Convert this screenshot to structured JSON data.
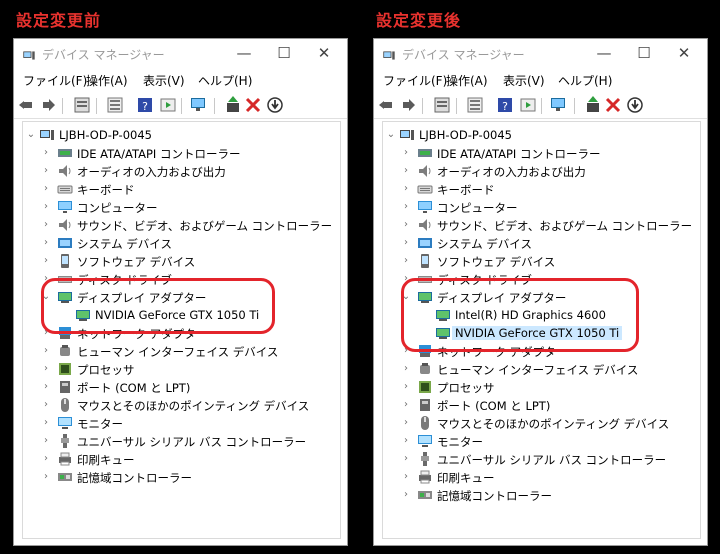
{
  "left": {
    "caption": "設定変更前",
    "window": {
      "title": "デバイス マネージャー",
      "min_glyph": "—",
      "max_glyph": "☐",
      "close_glyph": "✕",
      "menu": [
        "ファイル(F)",
        "操作(A)",
        "表示(V)",
        "ヘルプ(H)"
      ],
      "root": "LJBH-OD-P-0045",
      "categories": [
        {
          "label": "IDE ATA/ATAPI コントローラー",
          "icon": "ide-controller-icon"
        },
        {
          "label": "オーディオの入力および出力",
          "icon": "speaker-icon"
        },
        {
          "label": "キーボード",
          "icon": "keyboard-icon"
        },
        {
          "label": "コンピューター",
          "icon": "computer-icon"
        },
        {
          "label": "サウンド、ビデオ、およびゲーム コントローラー",
          "icon": "speaker-icon"
        },
        {
          "label": "システム デバイス",
          "icon": "system-device-icon"
        },
        {
          "label": "ソフトウェア デバイス",
          "icon": "software-device-icon"
        },
        {
          "label": "ディスク ドライブ",
          "icon": "disk-drive-icon"
        },
        {
          "label": "ディスプレイ アダプター",
          "icon": "display-adapter-icon",
          "expanded": true
        },
        {
          "label": "ネットワーク アダプタ",
          "icon": "network-adapter-icon"
        },
        {
          "label": "ヒューマン インターフェイス デバイス",
          "icon": "hid-icon"
        },
        {
          "label": "プロセッサ",
          "icon": "processor-icon"
        },
        {
          "label": "ポート (COM と LPT)",
          "icon": "port-icon"
        },
        {
          "label": "マウスとそのほかのポインティング デバイス",
          "icon": "mouse-icon"
        },
        {
          "label": "モニター",
          "icon": "monitor-icon"
        },
        {
          "label": "ユニバーサル シリアル バス コントローラー",
          "icon": "usb-icon"
        },
        {
          "label": "印刷キュー",
          "icon": "printer-icon"
        },
        {
          "label": "記憶域コントローラー",
          "icon": "storage-controller-icon"
        }
      ],
      "display_children": [
        "NVIDIA GeForce GTX 1050 Ti"
      ]
    }
  },
  "right": {
    "caption": "設定変更後",
    "window": {
      "title": "デバイス マネージャー",
      "min_glyph": "—",
      "max_glyph": "☐",
      "close_glyph": "✕",
      "menu": [
        "ファイル(F)",
        "操作(A)",
        "表示(V)",
        "ヘルプ(H)"
      ],
      "root": "LJBH-OD-P-0045",
      "categories": [
        {
          "label": "IDE ATA/ATAPI コントローラー",
          "icon": "ide-controller-icon"
        },
        {
          "label": "オーディオの入力および出力",
          "icon": "speaker-icon"
        },
        {
          "label": "キーボード",
          "icon": "keyboard-icon"
        },
        {
          "label": "コンピューター",
          "icon": "computer-icon"
        },
        {
          "label": "サウンド、ビデオ、およびゲーム コントローラー",
          "icon": "speaker-icon"
        },
        {
          "label": "システム デバイス",
          "icon": "system-device-icon"
        },
        {
          "label": "ソフトウェア デバイス",
          "icon": "software-device-icon"
        },
        {
          "label": "ディスク ドライブ",
          "icon": "disk-drive-icon"
        },
        {
          "label": "ディスプレイ アダプター",
          "icon": "display-adapter-icon",
          "expanded": true
        },
        {
          "label": "ネットワーク アダプタ",
          "icon": "network-adapter-icon"
        },
        {
          "label": "ヒューマン インターフェイス デバイス",
          "icon": "hid-icon"
        },
        {
          "label": "プロセッサ",
          "icon": "processor-icon"
        },
        {
          "label": "ポート (COM と LPT)",
          "icon": "port-icon"
        },
        {
          "label": "マウスとそのほかのポインティング デバイス",
          "icon": "mouse-icon"
        },
        {
          "label": "モニター",
          "icon": "monitor-icon"
        },
        {
          "label": "ユニバーサル シリアル バス コントローラー",
          "icon": "usb-icon"
        },
        {
          "label": "印刷キュー",
          "icon": "printer-icon"
        },
        {
          "label": "記憶域コントローラー",
          "icon": "storage-controller-icon"
        }
      ],
      "display_children": [
        "Intel(R) HD Graphics 4600",
        "NVIDIA GeForce GTX 1050 Ti"
      ],
      "selected_child": "NVIDIA GeForce GTX 1050 Ti"
    }
  },
  "colors": {
    "caption": "#e8322e",
    "highlight_ring": "#e3242b",
    "selection": "#cce8ff"
  }
}
